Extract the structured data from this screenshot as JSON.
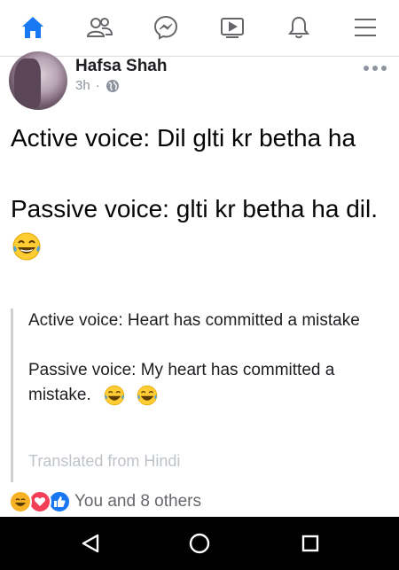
{
  "nav": {
    "items": [
      {
        "name": "home-icon",
        "active": true
      },
      {
        "name": "friends-icon",
        "active": false
      },
      {
        "name": "messenger-icon",
        "active": false
      },
      {
        "name": "watch-icon",
        "active": false
      },
      {
        "name": "notifications-icon",
        "active": false
      },
      {
        "name": "menu-icon",
        "active": false
      }
    ],
    "active_color": "#1877f2",
    "inactive_color": "#65676b"
  },
  "post": {
    "author": "Hafsa Shah",
    "time": "3h",
    "separator": "·",
    "privacy_icon": "public-globe-icon",
    "body_lines": [
      "Active voice: Dil glti kr betha ha",
      "Passive voice: glti kr betha ha dil."
    ],
    "translation": {
      "lines": [
        "Active voice: Heart has committed a mistake",
        "Passive voice: My heart has committed a mistake."
      ],
      "source_label": "Translated from Hindi"
    },
    "reactions": {
      "icons": [
        "haha-icon",
        "love-icon",
        "like-icon"
      ],
      "text": "You and 8 others"
    }
  },
  "system_nav": {
    "items": [
      "back-icon",
      "home-circle-icon",
      "recents-icon"
    ]
  }
}
